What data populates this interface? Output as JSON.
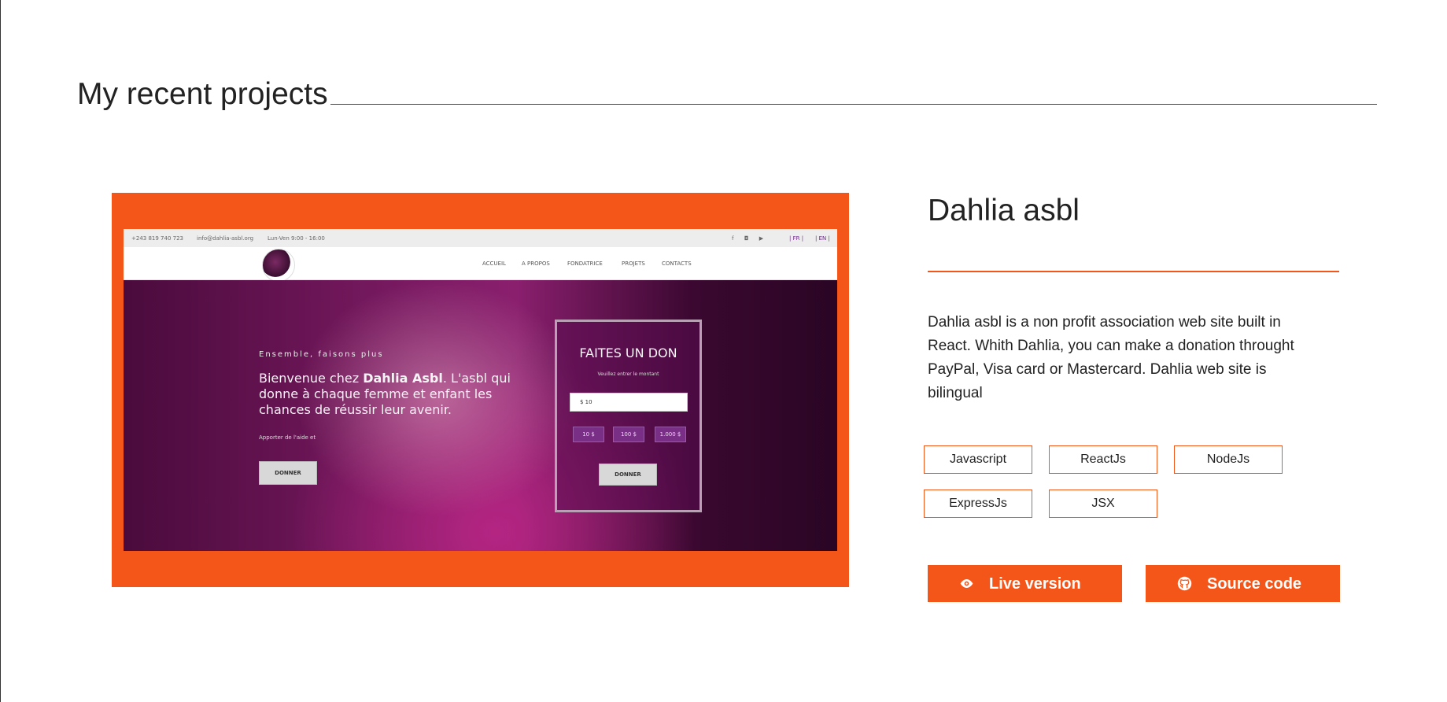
{
  "section": {
    "title": "My recent projects"
  },
  "project": {
    "title": "Dahlia asbl",
    "description": "Dahlia asbl is a non profit association web site built in React. Whith Dahlia, you can make a donation throught PayPal, Visa card or Mastercard. Dahlia web site is bilingual",
    "tags": [
      "Javascript",
      "ReactJs",
      "NodeJs",
      "ExpressJs",
      "JSX"
    ],
    "actions": {
      "live_label": "Live version",
      "source_label": "Source code"
    },
    "screenshot": {
      "topbar": {
        "phone": "+243 819 740 723",
        "email": "info@dahlia-asbl.org",
        "hours": "Lun-Ven 9:00 - 16:00",
        "lang_fr": "| FR |",
        "lang_en": "| EN |"
      },
      "nav": [
        "ACCUEIL",
        "A PROPOS",
        "FONDATRICE",
        "PROJETS",
        "CONTACTS"
      ],
      "hero": {
        "kicker": "Ensemble, faisons plus",
        "headline_pre": "Bienvenue chez ",
        "headline_bold": "Dahlia Asbl",
        "headline_post": ". L'asbl qui donne à chaque femme et enfant les chances de réussir leur avenir.",
        "small": "Apporter de l'aide et",
        "button": "DONNER"
      },
      "donation": {
        "title": "FAITES UN DON",
        "subtitle": "Veuillez entrer le montant",
        "input_value": "$     10",
        "amounts": [
          "10 $",
          "100 $",
          "1.000 $"
        ],
        "button": "DONNER"
      }
    }
  },
  "colors": {
    "accent": "#f45519",
    "text": "#222222",
    "hero_purple": "#7a1a62"
  },
  "icons": {
    "live": "eye-icon",
    "source": "github-icon"
  }
}
